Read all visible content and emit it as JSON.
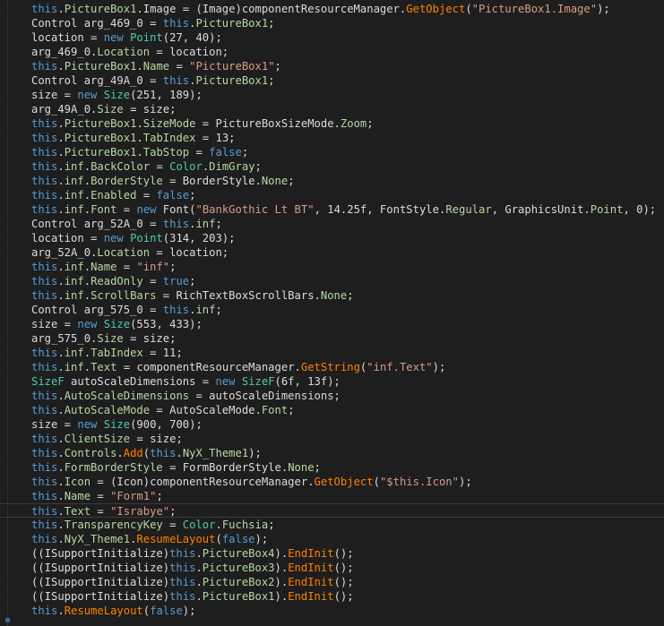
{
  "editor": {
    "language": "C#",
    "current_line_index": 35,
    "colors": {
      "background": "#1e1e1e",
      "keyword": "#569cd6",
      "type": "#4ec9b0",
      "string": "#d69d85",
      "method": "#ff8000",
      "member": "#b8d7a3",
      "text": "#dcdcdc"
    },
    "lines": [
      [
        [
          "kw",
          "this"
        ],
        [
          "tx",
          "."
        ],
        [
          "pr",
          "PictureBox1"
        ],
        [
          "tx",
          ".Image = (Image)componentResourceManager."
        ],
        [
          "mt",
          "GetObject"
        ],
        [
          "tx",
          "("
        ],
        [
          "st",
          "\"PictureBox1.Image\""
        ],
        [
          "tx",
          ");"
        ]
      ],
      [
        [
          "tx",
          "Control arg_469_0 = "
        ],
        [
          "kw",
          "this"
        ],
        [
          "tx",
          "."
        ],
        [
          "pr",
          "PictureBox1"
        ],
        [
          "tx",
          ";"
        ]
      ],
      [
        [
          "tx",
          "location = "
        ],
        [
          "kw",
          "new"
        ],
        [
          "tx",
          " "
        ],
        [
          "ty",
          "Point"
        ],
        [
          "tx",
          "(27, 40);"
        ]
      ],
      [
        [
          "tx",
          "arg_469_0."
        ],
        [
          "pr",
          "Location"
        ],
        [
          "tx",
          " = location;"
        ]
      ],
      [
        [
          "kw",
          "this"
        ],
        [
          "tx",
          "."
        ],
        [
          "pr",
          "PictureBox1"
        ],
        [
          "tx",
          "."
        ],
        [
          "pr",
          "Name"
        ],
        [
          "tx",
          " = "
        ],
        [
          "st",
          "\"PictureBox1\""
        ],
        [
          "tx",
          ";"
        ]
      ],
      [
        [
          "tx",
          "Control arg_49A_0 = "
        ],
        [
          "kw",
          "this"
        ],
        [
          "tx",
          "."
        ],
        [
          "pr",
          "PictureBox1"
        ],
        [
          "tx",
          ";"
        ]
      ],
      [
        [
          "tx",
          "size = "
        ],
        [
          "kw",
          "new"
        ],
        [
          "tx",
          " "
        ],
        [
          "ty",
          "Size"
        ],
        [
          "tx",
          "(251, 189);"
        ]
      ],
      [
        [
          "tx",
          "arg_49A_0."
        ],
        [
          "pr",
          "Size"
        ],
        [
          "tx",
          " = size;"
        ]
      ],
      [
        [
          "kw",
          "this"
        ],
        [
          "tx",
          "."
        ],
        [
          "pr",
          "PictureBox1"
        ],
        [
          "tx",
          "."
        ],
        [
          "pr",
          "SizeMode"
        ],
        [
          "tx",
          " = PictureBoxSizeMode."
        ],
        [
          "en",
          "Zoom"
        ],
        [
          "tx",
          ";"
        ]
      ],
      [
        [
          "kw",
          "this"
        ],
        [
          "tx",
          "."
        ],
        [
          "pr",
          "PictureBox1"
        ],
        [
          "tx",
          "."
        ],
        [
          "pr",
          "TabIndex"
        ],
        [
          "tx",
          " = 13;"
        ]
      ],
      [
        [
          "kw",
          "this"
        ],
        [
          "tx",
          "."
        ],
        [
          "pr",
          "PictureBox1"
        ],
        [
          "tx",
          "."
        ],
        [
          "pr",
          "TabStop"
        ],
        [
          "tx",
          " = "
        ],
        [
          "kw",
          "false"
        ],
        [
          "tx",
          ";"
        ]
      ],
      [
        [
          "kw",
          "this"
        ],
        [
          "tx",
          "."
        ],
        [
          "pr",
          "inf"
        ],
        [
          "tx",
          "."
        ],
        [
          "pr",
          "BackColor"
        ],
        [
          "tx",
          " = "
        ],
        [
          "ty",
          "Color"
        ],
        [
          "tx",
          "."
        ],
        [
          "en",
          "DimGray"
        ],
        [
          "tx",
          ";"
        ]
      ],
      [
        [
          "kw",
          "this"
        ],
        [
          "tx",
          "."
        ],
        [
          "pr",
          "inf"
        ],
        [
          "tx",
          "."
        ],
        [
          "pr",
          "BorderStyle"
        ],
        [
          "tx",
          " = BorderStyle."
        ],
        [
          "en",
          "None"
        ],
        [
          "tx",
          ";"
        ]
      ],
      [
        [
          "kw",
          "this"
        ],
        [
          "tx",
          "."
        ],
        [
          "pr",
          "inf"
        ],
        [
          "tx",
          "."
        ],
        [
          "pr",
          "Enabled"
        ],
        [
          "tx",
          " = "
        ],
        [
          "kw",
          "false"
        ],
        [
          "tx",
          ";"
        ]
      ],
      [
        [
          "kw",
          "this"
        ],
        [
          "tx",
          "."
        ],
        [
          "pr",
          "inf"
        ],
        [
          "tx",
          "."
        ],
        [
          "pr",
          "Font"
        ],
        [
          "tx",
          " = "
        ],
        [
          "kw",
          "new"
        ],
        [
          "tx",
          " Font("
        ],
        [
          "st",
          "\"BankGothic Lt BT\""
        ],
        [
          "tx",
          ", 14.25f, FontStyle."
        ],
        [
          "en",
          "Regular"
        ],
        [
          "tx",
          ", GraphicsUnit."
        ],
        [
          "en",
          "Point"
        ],
        [
          "tx",
          ", 0);"
        ]
      ],
      [
        [
          "tx",
          "Control arg_52A_0 = "
        ],
        [
          "kw",
          "this"
        ],
        [
          "tx",
          "."
        ],
        [
          "pr",
          "inf"
        ],
        [
          "tx",
          ";"
        ]
      ],
      [
        [
          "tx",
          "location = "
        ],
        [
          "kw",
          "new"
        ],
        [
          "tx",
          " "
        ],
        [
          "ty",
          "Point"
        ],
        [
          "tx",
          "(314, 203);"
        ]
      ],
      [
        [
          "tx",
          "arg_52A_0."
        ],
        [
          "pr",
          "Location"
        ],
        [
          "tx",
          " = location;"
        ]
      ],
      [
        [
          "kw",
          "this"
        ],
        [
          "tx",
          "."
        ],
        [
          "pr",
          "inf"
        ],
        [
          "tx",
          "."
        ],
        [
          "pr",
          "Name"
        ],
        [
          "tx",
          " = "
        ],
        [
          "st",
          "\"inf\""
        ],
        [
          "tx",
          ";"
        ]
      ],
      [
        [
          "kw",
          "this"
        ],
        [
          "tx",
          "."
        ],
        [
          "pr",
          "inf"
        ],
        [
          "tx",
          "."
        ],
        [
          "pr",
          "ReadOnly"
        ],
        [
          "tx",
          " = "
        ],
        [
          "kw",
          "true"
        ],
        [
          "tx",
          ";"
        ]
      ],
      [
        [
          "kw",
          "this"
        ],
        [
          "tx",
          "."
        ],
        [
          "pr",
          "inf"
        ],
        [
          "tx",
          "."
        ],
        [
          "pr",
          "ScrollBars"
        ],
        [
          "tx",
          " = RichTextBoxScrollBars."
        ],
        [
          "en",
          "None"
        ],
        [
          "tx",
          ";"
        ]
      ],
      [
        [
          "tx",
          "Control arg_575_0 = "
        ],
        [
          "kw",
          "this"
        ],
        [
          "tx",
          "."
        ],
        [
          "pr",
          "inf"
        ],
        [
          "tx",
          ";"
        ]
      ],
      [
        [
          "tx",
          "size = "
        ],
        [
          "kw",
          "new"
        ],
        [
          "tx",
          " "
        ],
        [
          "ty",
          "Size"
        ],
        [
          "tx",
          "(553, 433);"
        ]
      ],
      [
        [
          "tx",
          "arg_575_0."
        ],
        [
          "pr",
          "Size"
        ],
        [
          "tx",
          " = size;"
        ]
      ],
      [
        [
          "kw",
          "this"
        ],
        [
          "tx",
          "."
        ],
        [
          "pr",
          "inf"
        ],
        [
          "tx",
          "."
        ],
        [
          "pr",
          "TabIndex"
        ],
        [
          "tx",
          " = 11;"
        ]
      ],
      [
        [
          "kw",
          "this"
        ],
        [
          "tx",
          "."
        ],
        [
          "pr",
          "inf"
        ],
        [
          "tx",
          "."
        ],
        [
          "pr",
          "Text"
        ],
        [
          "tx",
          " = componentResourceManager."
        ],
        [
          "mt",
          "GetString"
        ],
        [
          "tx",
          "("
        ],
        [
          "st",
          "\"inf.Text\""
        ],
        [
          "tx",
          ");"
        ]
      ],
      [
        [
          "ty",
          "SizeF"
        ],
        [
          "tx",
          " autoScaleDimensions = "
        ],
        [
          "kw",
          "new"
        ],
        [
          "tx",
          " "
        ],
        [
          "ty",
          "SizeF"
        ],
        [
          "tx",
          "(6f, 13f);"
        ]
      ],
      [
        [
          "kw",
          "this"
        ],
        [
          "tx",
          "."
        ],
        [
          "pr",
          "AutoScaleDimensions"
        ],
        [
          "tx",
          " = autoScaleDimensions;"
        ]
      ],
      [
        [
          "kw",
          "this"
        ],
        [
          "tx",
          "."
        ],
        [
          "pr",
          "AutoScaleMode"
        ],
        [
          "tx",
          " = AutoScaleMode."
        ],
        [
          "en",
          "Font"
        ],
        [
          "tx",
          ";"
        ]
      ],
      [
        [
          "tx",
          "size = "
        ],
        [
          "kw",
          "new"
        ],
        [
          "tx",
          " "
        ],
        [
          "ty",
          "Size"
        ],
        [
          "tx",
          "(900, 700);"
        ]
      ],
      [
        [
          "kw",
          "this"
        ],
        [
          "tx",
          "."
        ],
        [
          "pr",
          "ClientSize"
        ],
        [
          "tx",
          " = size;"
        ]
      ],
      [
        [
          "kw",
          "this"
        ],
        [
          "tx",
          "."
        ],
        [
          "pr",
          "Controls"
        ],
        [
          "tx",
          "."
        ],
        [
          "mt",
          "Add"
        ],
        [
          "tx",
          "("
        ],
        [
          "kw",
          "this"
        ],
        [
          "tx",
          "."
        ],
        [
          "pr",
          "NyX_Theme1"
        ],
        [
          "tx",
          ");"
        ]
      ],
      [
        [
          "kw",
          "this"
        ],
        [
          "tx",
          "."
        ],
        [
          "pr",
          "FormBorderStyle"
        ],
        [
          "tx",
          " = FormBorderStyle."
        ],
        [
          "en",
          "None"
        ],
        [
          "tx",
          ";"
        ]
      ],
      [
        [
          "kw",
          "this"
        ],
        [
          "tx",
          "."
        ],
        [
          "pr",
          "Icon"
        ],
        [
          "tx",
          " = (Icon)componentResourceManager."
        ],
        [
          "mt",
          "GetObject"
        ],
        [
          "tx",
          "("
        ],
        [
          "st",
          "\"$this.Icon\""
        ],
        [
          "tx",
          ");"
        ]
      ],
      [
        [
          "kw",
          "this"
        ],
        [
          "tx",
          "."
        ],
        [
          "pr",
          "Name"
        ],
        [
          "tx",
          " = "
        ],
        [
          "st",
          "\"Form1\""
        ],
        [
          "tx",
          ";"
        ]
      ],
      [
        [
          "kw",
          "this"
        ],
        [
          "tx",
          "."
        ],
        [
          "pr",
          "Text"
        ],
        [
          "tx",
          " = "
        ],
        [
          "st",
          "\"Israbye\""
        ],
        [
          "tx",
          ";"
        ]
      ],
      [
        [
          "kw",
          "this"
        ],
        [
          "tx",
          "."
        ],
        [
          "pr",
          "TransparencyKey"
        ],
        [
          "tx",
          " = "
        ],
        [
          "ty",
          "Color"
        ],
        [
          "tx",
          "."
        ],
        [
          "en",
          "Fuchsia"
        ],
        [
          "tx",
          ";"
        ]
      ],
      [
        [
          "kw",
          "this"
        ],
        [
          "tx",
          "."
        ],
        [
          "pr",
          "NyX_Theme1"
        ],
        [
          "tx",
          "."
        ],
        [
          "mt",
          "ResumeLayout"
        ],
        [
          "tx",
          "("
        ],
        [
          "kw",
          "false"
        ],
        [
          "tx",
          ");"
        ]
      ],
      [
        [
          "tx",
          "((ISupportInitialize)"
        ],
        [
          "kw",
          "this"
        ],
        [
          "tx",
          "."
        ],
        [
          "pr",
          "PictureBox4"
        ],
        [
          "tx",
          ")."
        ],
        [
          "mt",
          "EndInit"
        ],
        [
          "tx",
          "();"
        ]
      ],
      [
        [
          "tx",
          "((ISupportInitialize)"
        ],
        [
          "kw",
          "this"
        ],
        [
          "tx",
          "."
        ],
        [
          "pr",
          "PictureBox3"
        ],
        [
          "tx",
          ")."
        ],
        [
          "mt",
          "EndInit"
        ],
        [
          "tx",
          "();"
        ]
      ],
      [
        [
          "tx",
          "((ISupportInitialize)"
        ],
        [
          "kw",
          "this"
        ],
        [
          "tx",
          "."
        ],
        [
          "pr",
          "PictureBox2"
        ],
        [
          "tx",
          ")."
        ],
        [
          "mt",
          "EndInit"
        ],
        [
          "tx",
          "();"
        ]
      ],
      [
        [
          "tx",
          "((ISupportInitialize)"
        ],
        [
          "kw",
          "this"
        ],
        [
          "tx",
          "."
        ],
        [
          "pr",
          "PictureBox1"
        ],
        [
          "tx",
          ")."
        ],
        [
          "mt",
          "EndInit"
        ],
        [
          "tx",
          "();"
        ]
      ],
      [
        [
          "kw",
          "this"
        ],
        [
          "tx",
          "."
        ],
        [
          "mt",
          "ResumeLayout"
        ],
        [
          "tx",
          "("
        ],
        [
          "kw",
          "false"
        ],
        [
          "tx",
          ");"
        ]
      ]
    ]
  }
}
